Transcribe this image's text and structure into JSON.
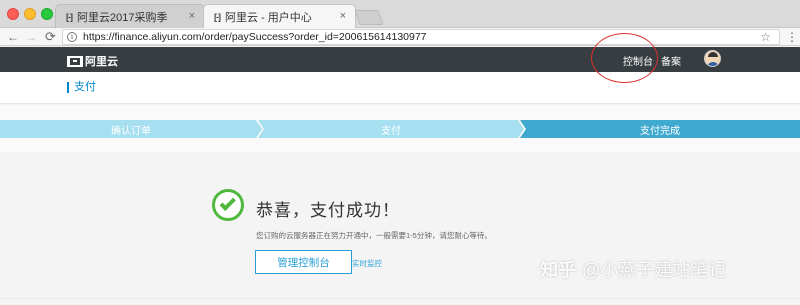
{
  "browser": {
    "tabs": [
      {
        "favicon": "[-]",
        "title": "阿里云2017采购季",
        "close": "×"
      },
      {
        "favicon": "[-]",
        "title": "阿里云 - 用户中心",
        "close": "×"
      }
    ],
    "url": "https://finance.aliyun.com/order/paySuccess?order_id=200615614130977",
    "back_glyph": "←",
    "forward_glyph": "→",
    "reload_glyph": "⟳",
    "info_glyph": "i",
    "star_glyph": "☆",
    "menu_glyph": "⋮"
  },
  "header": {
    "logo_text": "阿里云",
    "nav": {
      "console": "控制台",
      "beian": "备案"
    },
    "highlight_color": "#d9332c",
    "bg_color": "#373d41"
  },
  "page": {
    "title": "支付"
  },
  "steps": [
    {
      "label": "确认订单",
      "state": "done"
    },
    {
      "label": "支付",
      "state": "done"
    },
    {
      "label": "支付完成",
      "state": "current"
    }
  ],
  "success": {
    "title": "恭喜，支付成功！",
    "description": "您订购的云服务器正在努力开通中，一般需要1-5分钟，请您耐心等待。",
    "console_button": "管理控制台",
    "monitor_link": "实时监控",
    "accent_color": "#4fb83d",
    "link_color": "#2a9fd6"
  },
  "watermark": {
    "brand": "知乎",
    "author": "@小燕子建站笔记"
  }
}
